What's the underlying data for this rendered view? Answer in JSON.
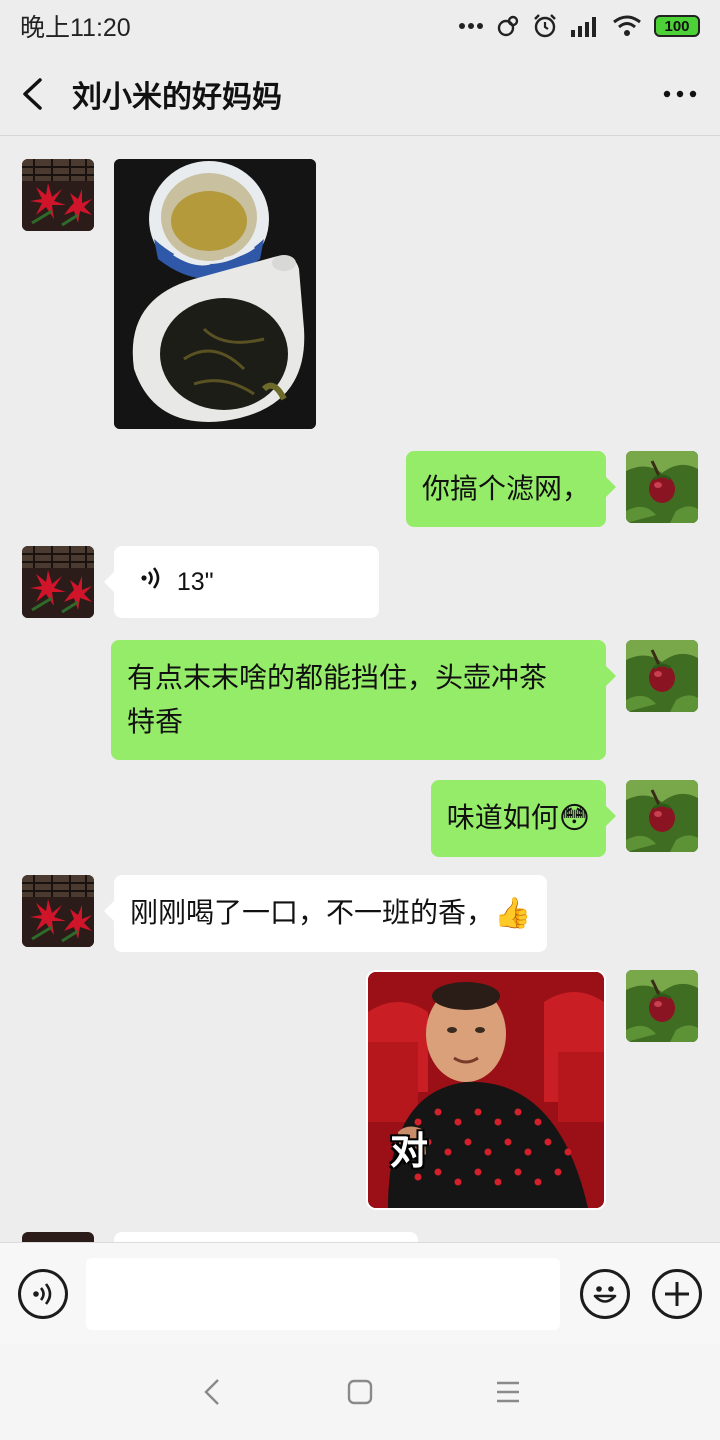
{
  "status_bar": {
    "time": "晚上11:20",
    "battery": "100",
    "icons": [
      "more-dots-icon",
      "link-icon",
      "alarm-icon",
      "signal-icon",
      "wifi-icon",
      "battery-icon"
    ]
  },
  "header": {
    "title": "刘小米的好妈妈",
    "back_icon": "chevron-left-icon",
    "more_icon": "more-horizontal-icon"
  },
  "messages": [
    {
      "side": "left",
      "type": "image",
      "subject": "tea-photo"
    },
    {
      "side": "right",
      "type": "text",
      "text": "你搞个滤网，"
    },
    {
      "side": "left",
      "type": "voice",
      "duration": "13\""
    },
    {
      "side": "right",
      "type": "text",
      "text_line1": "有点末末啥的都能挡住，头壶冲茶",
      "text_line2": "特香"
    },
    {
      "side": "right",
      "type": "text",
      "text": "味道如何",
      "emoji": "😳"
    },
    {
      "side": "left",
      "type": "text",
      "text": "刚刚喝了一口，不一班的香，",
      "emoji": "👍"
    },
    {
      "side": "right",
      "type": "sticker",
      "caption": "对"
    }
  ],
  "input_bar": {
    "voice_icon": "voice-toggle-icon",
    "placeholder": "",
    "emoji_icon": "emoji-icon",
    "plus_icon": "plus-icon"
  },
  "colors": {
    "background": "#ededed",
    "green_bubble": "#95ec69",
    "white_bubble": "#ffffff"
  }
}
